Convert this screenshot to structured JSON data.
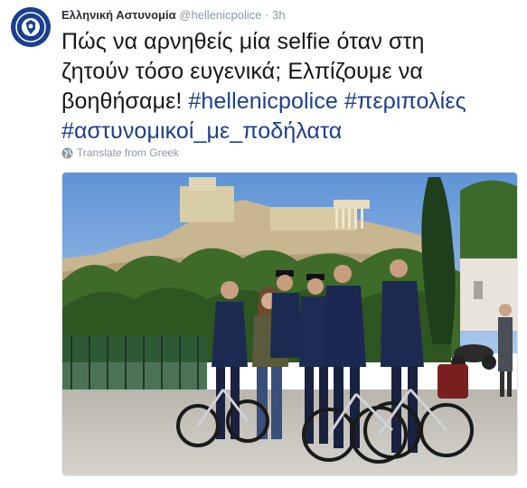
{
  "tweet": {
    "author_name": "Ελληνική Αστυνομία",
    "author_handle": "@hellenicpolice",
    "separator": "·",
    "time": "3h",
    "text_line_1": "Πώς να αρνηθείς μία selfie όταν στη",
    "text_line_2": "ζητούν τόσο ευγενικά; Ελπίζουμε να",
    "text_line_3_prefix": "βοηθήσαμε!",
    "hashtags": [
      "#hellenicpolice",
      "#περιπολίες",
      "#αστυνομικοί_με_ποδήλατα"
    ],
    "translate_label": "Translate from Greek"
  },
  "avatar": {
    "icon": "police-emblem-icon",
    "color": "#1b3f8f"
  },
  "photo": {
    "icon": "photo-police-cyclists-acropolis"
  },
  "colors": {
    "link": "#1b3f8f",
    "meta": "#8899a6",
    "text": "#14171a"
  }
}
